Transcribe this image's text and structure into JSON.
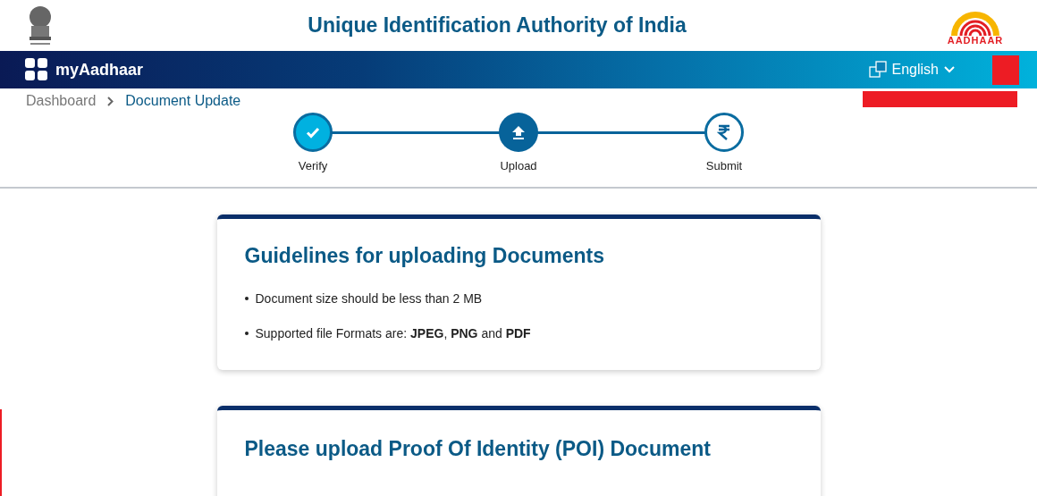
{
  "header": {
    "title": "Unique Identification Authority of India",
    "logo_text": "AADHAAR"
  },
  "navbar": {
    "brand": "myAadhaar",
    "language": "English"
  },
  "breadcrumb": [
    {
      "label": "Dashboard",
      "selected": false
    },
    {
      "label": "Document Update",
      "selected": true
    }
  ],
  "steps": [
    {
      "label": "Verify",
      "completed": true,
      "selected": false
    },
    {
      "label": "Upload",
      "completed": false,
      "selected": true
    },
    {
      "label": "Submit",
      "completed": false,
      "selected": false
    }
  ],
  "guidelines": {
    "title": "Guidelines for uploading Documents",
    "items": [
      "Document size should be less than 2 MB",
      "Supported file Formats are: **JPEG**, **PNG** and **PDF**"
    ]
  },
  "poi_card": {
    "title": "Please upload Proof Of Identity (POI) Document"
  }
}
